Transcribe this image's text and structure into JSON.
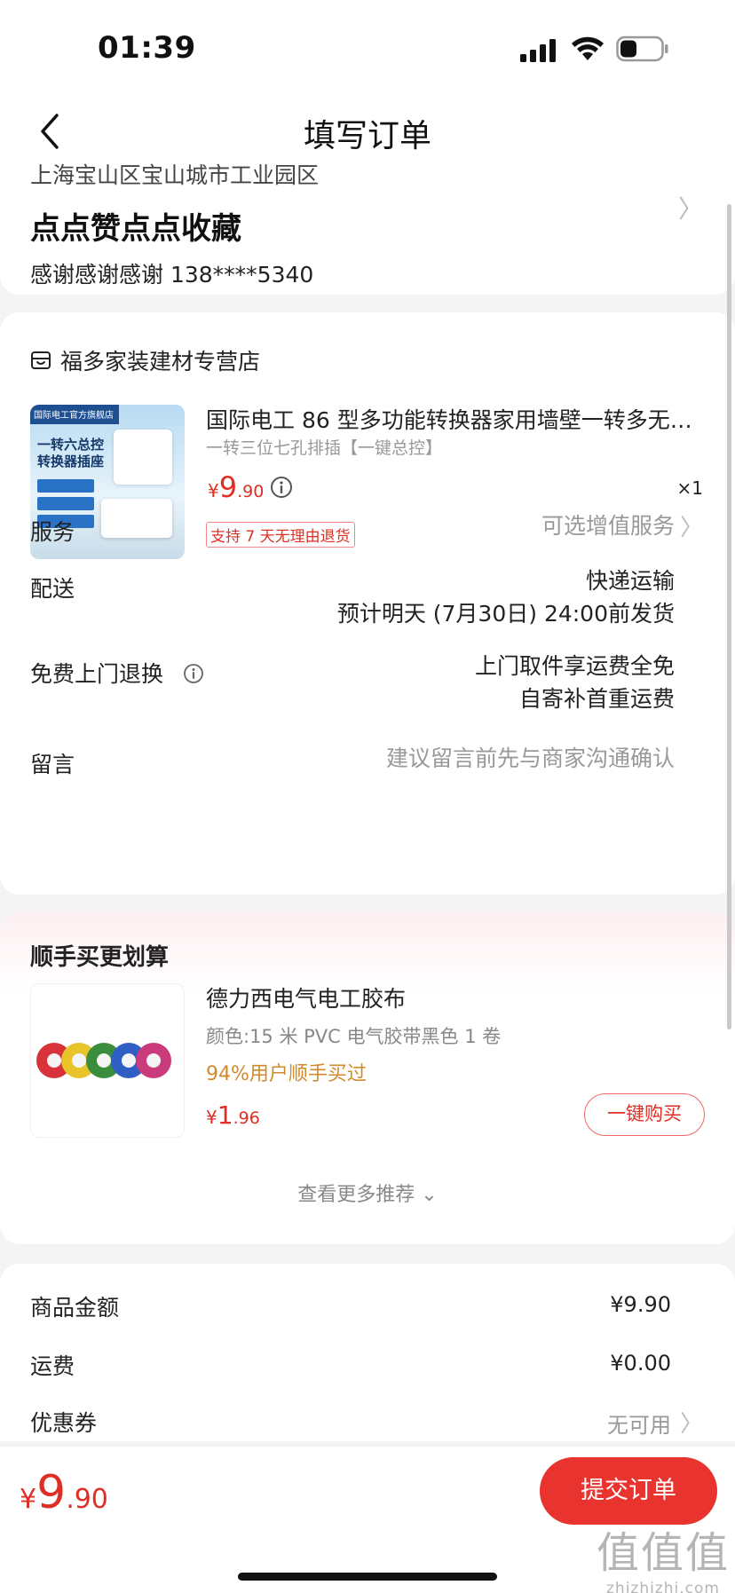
{
  "status_bar": {
    "time": "01:39"
  },
  "nav": {
    "title": "填写订单"
  },
  "address": {
    "line": "上海宝山区宝山城市工业园区",
    "name": "点点赞点点收藏",
    "contact": "感谢感谢感谢  138****5340"
  },
  "shop": {
    "name": "福多家装建材专营店"
  },
  "product": {
    "title": "国际电工 86 型多功能转换器家用墙壁一转多无…",
    "spec": "一转三位七孔排插【一键总控】",
    "price_yen": "¥",
    "price_int": "9",
    "price_dec": ".90",
    "qty": "×1",
    "return_badge": "支持 7 天无理由退货",
    "image_texts": {
      "tag": "国际电工官方旗舰店",
      "headline_1": "一转六总控",
      "headline_2": "转换器插座"
    }
  },
  "rows": {
    "service": {
      "label": "服务",
      "value": "可选增值服务"
    },
    "delivery": {
      "label": "配送",
      "value_1": "快递运输",
      "value_2": "预计明天 (7月30日) 24:00前发货"
    },
    "free_return": {
      "label": "免费上门退换",
      "value_1": "上门取件享运费全免",
      "value_2": "自寄补首重运费"
    },
    "message": {
      "label": "留言",
      "placeholder": "建议留言前先与商家沟通确认"
    }
  },
  "recommend": {
    "title": "顺手买更划算",
    "item": {
      "name": "德力西电气电工胶布",
      "spec": "颜色:15 米 PVC 电气胶带黑色 1 卷",
      "stat": "94%用户顺手买过",
      "price_yen": "¥",
      "price_int": "1",
      "price_dec": ".96",
      "buy_label": "一键购买"
    },
    "more_label": "查看更多推荐 ⌄"
  },
  "summary": {
    "goods": {
      "label": "商品金额",
      "value": "¥9.90"
    },
    "shipping": {
      "label": "运费",
      "value": "¥0.00"
    },
    "coupon": {
      "label": "优惠券",
      "value": "无可用"
    }
  },
  "bottom": {
    "total_yen": "¥",
    "total_int": "9",
    "total_dec": ".90",
    "submit_label": "提交订单"
  },
  "watermark": {
    "big": "值值值",
    "small": "zhizhizhi.com"
  },
  "colors": {
    "accent": "#e8332f",
    "price": "#e02e24",
    "stat": "#d38a2c"
  }
}
